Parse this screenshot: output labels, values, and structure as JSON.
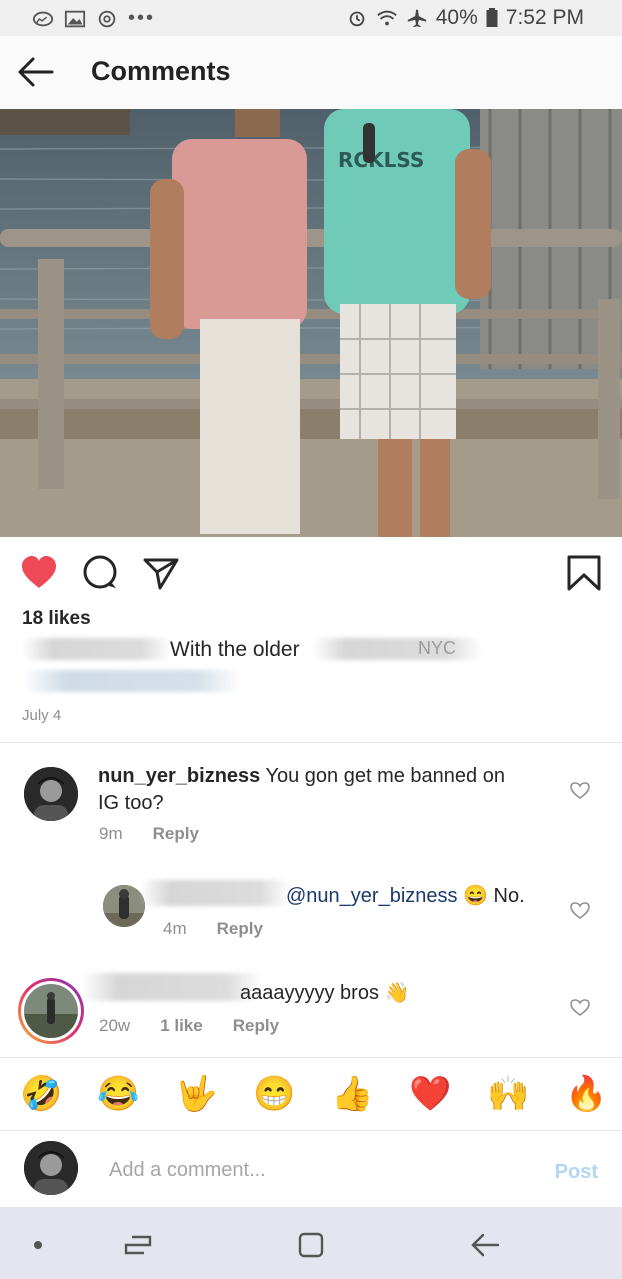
{
  "status_bar": {
    "battery": "40%",
    "time": "7:52 PM"
  },
  "header": {
    "title": "Comments"
  },
  "post": {
    "likes": "18 likes",
    "caption_text": "With the older",
    "caption_fragment": "NYC",
    "date": "July 4"
  },
  "comments": [
    {
      "username": "nun_yer_bizness",
      "text": "You gon get me banned on IG too?",
      "age": "9m",
      "reply": "Reply"
    },
    {
      "mention": "@nun_yer_bizness",
      "emoji": "😄",
      "text": "No.",
      "age": "4m",
      "reply": "Reply"
    },
    {
      "text": "aaaayyyyy bros",
      "emoji": "👋",
      "age": "20w",
      "likes": "1 like",
      "reply": "Reply"
    }
  ],
  "quick_reactions": [
    "🤣",
    "😂",
    "🤟",
    "😁",
    "👍",
    "❤️",
    "🙌",
    "🔥"
  ],
  "composer": {
    "placeholder": "Add a comment...",
    "post": "Post"
  },
  "colors": {
    "heart": "#ed4956",
    "mention": "#1d3a6e",
    "post_disabled": "#b3d6f5"
  }
}
